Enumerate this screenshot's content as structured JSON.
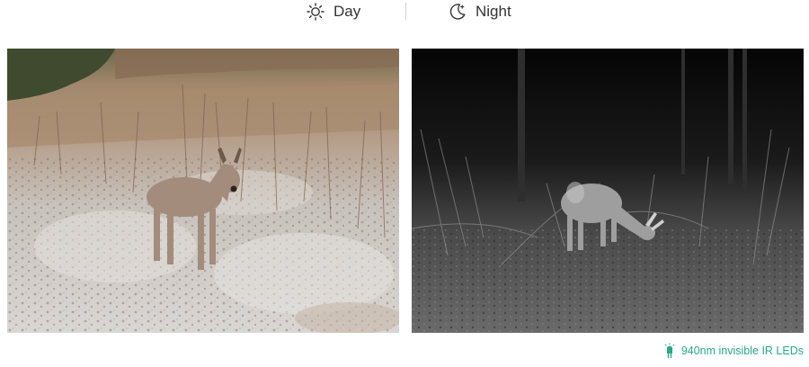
{
  "header": {
    "day": {
      "icon": "sun-icon",
      "label": "Day"
    },
    "night": {
      "icon": "moon-icon",
      "label": "Night"
    }
  },
  "photos": {
    "day": {
      "type": "color daytime trail-camera photo"
    },
    "night": {
      "type": "black-and-white infrared night photo"
    }
  },
  "footer": {
    "icon": "ir-led-icon",
    "text": "940nm invisible IR LEDs",
    "color": "#2aa88a"
  }
}
